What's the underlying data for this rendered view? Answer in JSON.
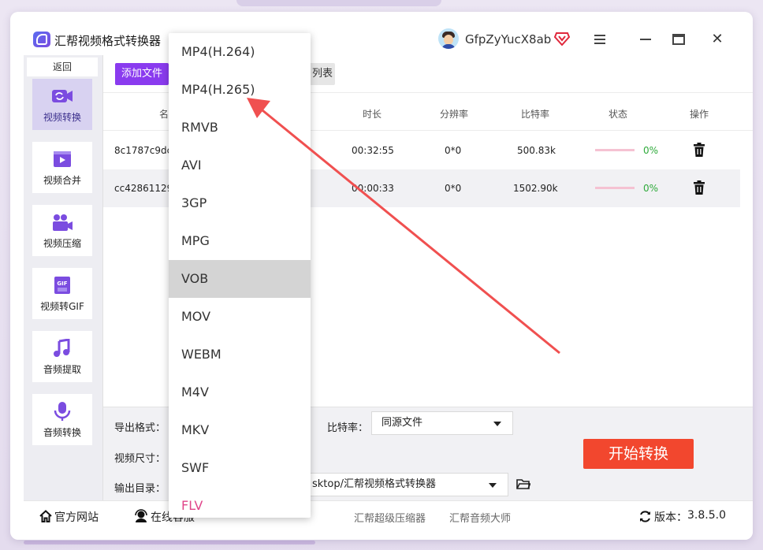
{
  "app": {
    "title": "汇帮视频格式转换器",
    "username": "GfpZyYucX8ab"
  },
  "sidebar": {
    "back_label": "返回",
    "items": [
      {
        "label": "视频转换",
        "icon": "video-convert-icon",
        "active": true
      },
      {
        "label": "视频合并",
        "icon": "video-merge-icon",
        "active": false
      },
      {
        "label": "视频压缩",
        "icon": "video-compress-icon",
        "active": false
      },
      {
        "label": "视频转GIF",
        "icon": "gif-icon",
        "active": false
      },
      {
        "label": "音频提取",
        "icon": "music-note-icon",
        "active": false
      },
      {
        "label": "音频转换",
        "icon": "microphone-icon",
        "active": false
      }
    ]
  },
  "toolbar": {
    "add_file_label": "添加文件",
    "list_label_visible": "列表"
  },
  "table": {
    "headers": {
      "name": "名",
      "duration": "时长",
      "resolution": "分辨率",
      "bitrate": "比特率",
      "status": "状态",
      "action": "操作"
    },
    "rows": [
      {
        "name": "8c1787c9dca",
        "duration": "00:32:55",
        "resolution": "0*0",
        "bitrate": "500.83k",
        "progress": "0%"
      },
      {
        "name": "cc42861129",
        "duration": "00:00:33",
        "resolution": "0*0",
        "bitrate": "1502.90k",
        "progress": "0%"
      }
    ]
  },
  "settings": {
    "export_format_label": "导出格式：",
    "video_size_label": "视频尺寸：",
    "output_dir_label": "输出目录：",
    "bitrate_label": "比特率：",
    "bitrate_value": "同源文件",
    "output_dir_value": "sktop/汇帮视频格式转换器",
    "start_button": "开始转换"
  },
  "footer": {
    "official_site": "官方网站",
    "online_service": "在线客服",
    "product_1": "汇帮超级压缩器",
    "product_2": "汇帮音频大师",
    "version_label": "版本：",
    "version": "3.8.5.0"
  },
  "format_dropdown": {
    "options": [
      "MP4(H.264)",
      "MP4(H.265)",
      "RMVB",
      "AVI",
      "3GP",
      "MPG",
      "VOB",
      "MOV",
      "WEBM",
      "M4V",
      "MKV",
      "SWF",
      "FLV"
    ],
    "highlighted": "VOB"
  },
  "colors": {
    "accent_purple": "#8a3bef",
    "start_button": "#f2472e",
    "progress_pct": "#2eaa3a",
    "annotation_arrow": "#f05050"
  }
}
